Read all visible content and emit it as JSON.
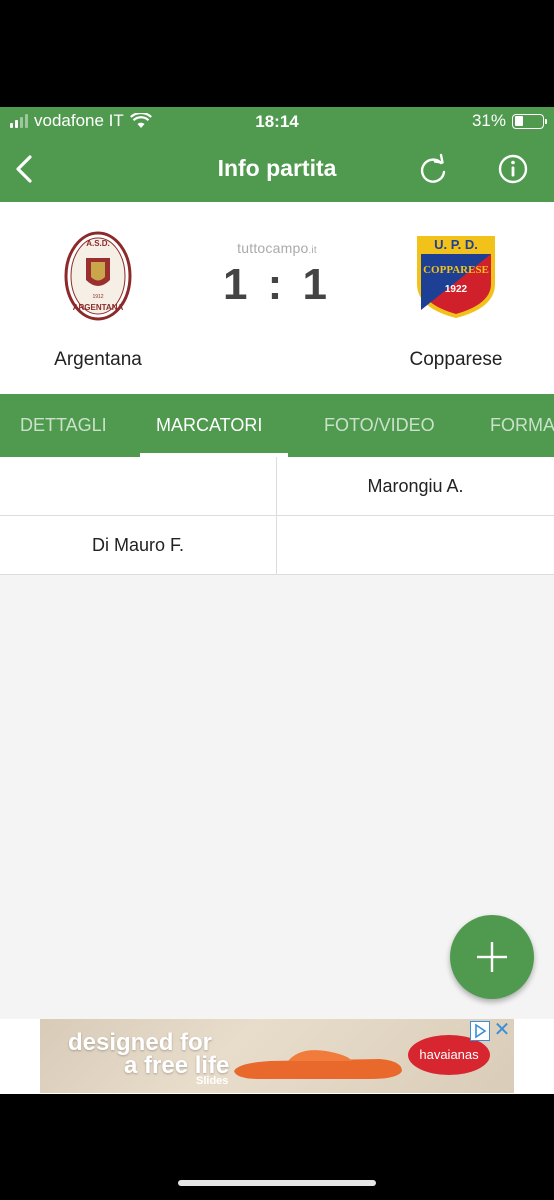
{
  "status_bar": {
    "carrier": "vodafone IT",
    "time": "18:14",
    "battery": "31%",
    "battery_level": 0.31
  },
  "app_bar": {
    "title": "Info partita"
  },
  "match": {
    "brand": "tuttocampo",
    "brand_suffix": ".it",
    "score": "1 : 1",
    "home": {
      "name": "Argentana",
      "crest_top": "A.S.D.",
      "crest_year": "1912",
      "crest_bottom": "ARGENTANA"
    },
    "away": {
      "name": "Copparese",
      "crest_top": "U. P. D.",
      "crest_middle": "COPPARESE",
      "crest_year": "1922"
    }
  },
  "tabs": [
    {
      "label": "DETTAGLI",
      "active": false
    },
    {
      "label": "MARCATORI",
      "active": true
    },
    {
      "label": "FOTO/VIDEO",
      "active": false
    },
    {
      "label": "FORMAZIONI",
      "active": false
    }
  ],
  "scorers": [
    {
      "home": "",
      "away": "Marongiu A."
    },
    {
      "home": "Di Mauro F.",
      "away": ""
    }
  ],
  "ad": {
    "line1": "designed for",
    "line2": "a free life",
    "line3": "Slides",
    "brand": "havaianas"
  },
  "colors": {
    "primary": "#4f9a4f",
    "background": "#f4f4f4",
    "home_crest": "#8c2a2a",
    "away_crest_blue": "#1d3f94",
    "away_crest_red": "#d0202b"
  }
}
